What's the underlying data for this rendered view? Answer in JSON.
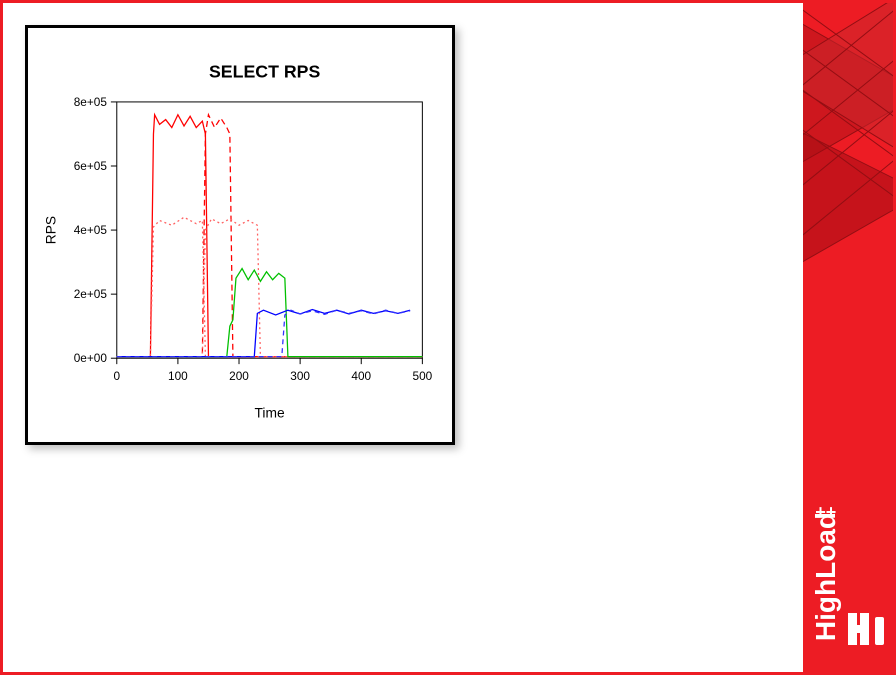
{
  "brand": {
    "name": "HighLoad",
    "plus": "++"
  },
  "chart_data": {
    "type": "line",
    "title": "SELECT RPS",
    "xlabel": "Time",
    "ylabel": "RPS",
    "xlim": [
      0,
      500
    ],
    "ylim": [
      0,
      800000
    ],
    "xticks": [
      0,
      100,
      200,
      300,
      400,
      500
    ],
    "yticks": [
      0,
      200000,
      400000,
      600000,
      800000
    ],
    "ytick_labels": [
      "0e+00",
      "2e+05",
      "4e+05",
      "6e+05",
      "8e+05"
    ],
    "series": [
      {
        "name": "red-solid",
        "color": "#ff0000",
        "dash": "none",
        "x": [
          0,
          55,
          60,
          62,
          70,
          80,
          90,
          100,
          110,
          120,
          130,
          140,
          145,
          150,
          500
        ],
        "y": [
          5000,
          5000,
          700000,
          760000,
          730000,
          745000,
          720000,
          760000,
          725000,
          755000,
          720000,
          740000,
          700000,
          5000,
          5000
        ]
      },
      {
        "name": "red-dashed",
        "color": "#ff0000",
        "dash": "6,4",
        "x": [
          0,
          140,
          145,
          150,
          160,
          170,
          180,
          185,
          190,
          500
        ],
        "y": [
          5000,
          5000,
          700000,
          760000,
          720000,
          750000,
          720000,
          700000,
          5000,
          5000
        ]
      },
      {
        "name": "red-dotted-1",
        "color": "#ff6060",
        "dash": "2,3",
        "x": [
          0,
          55,
          60,
          70,
          90,
          110,
          130,
          140,
          145,
          500
        ],
        "y": [
          5000,
          5000,
          410000,
          430000,
          415000,
          440000,
          420000,
          430000,
          5000,
          5000
        ]
      },
      {
        "name": "red-dotted-2",
        "color": "#ff6060",
        "dash": "2,3",
        "x": [
          0,
          140,
          145,
          155,
          170,
          185,
          200,
          215,
          230,
          235,
          500
        ],
        "y": [
          5000,
          5000,
          400000,
          435000,
          420000,
          435000,
          415000,
          430000,
          415000,
          5000,
          5000
        ]
      },
      {
        "name": "green-solid",
        "color": "#00c000",
        "dash": "none",
        "x": [
          0,
          180,
          185,
          190,
          195,
          205,
          215,
          225,
          235,
          245,
          255,
          265,
          275,
          280,
          500
        ],
        "y": [
          5000,
          5000,
          100000,
          120000,
          250000,
          280000,
          245000,
          275000,
          240000,
          270000,
          245000,
          265000,
          250000,
          5000,
          5000
        ]
      },
      {
        "name": "blue-solid",
        "color": "#0000ff",
        "dash": "none",
        "x": [
          0,
          225,
          230,
          240,
          260,
          280,
          300,
          320,
          340,
          360,
          380,
          400,
          420,
          440,
          460,
          480
        ],
        "y": [
          5000,
          5000,
          140000,
          150000,
          135000,
          150000,
          138000,
          152000,
          140000,
          150000,
          138000,
          150000,
          140000,
          148000,
          140000,
          150000
        ]
      },
      {
        "name": "blue-dashed",
        "color": "#3030ff",
        "dash": "5,4",
        "x": [
          0,
          270,
          275,
          285,
          300,
          320,
          340,
          360,
          380,
          400,
          420,
          440,
          460,
          480
        ],
        "y": [
          5000,
          5000,
          135000,
          150000,
          138000,
          148000,
          137000,
          150000,
          140000,
          148000,
          138000,
          150000,
          140000,
          148000
        ]
      }
    ]
  }
}
